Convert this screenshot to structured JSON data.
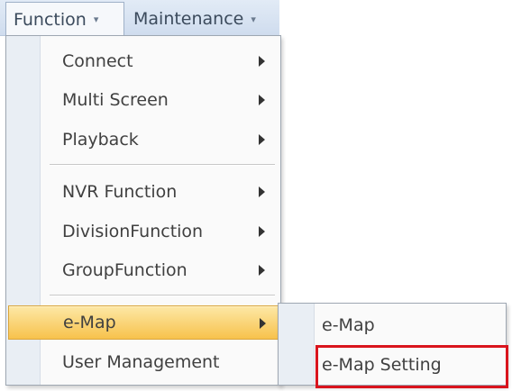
{
  "menubar": {
    "function_label": "Function",
    "maintenance_label": "Maintenance",
    "caret": "▾"
  },
  "function_menu": {
    "items": [
      {
        "label": "Connect",
        "has_submenu": true
      },
      {
        "label": "Multi Screen",
        "has_submenu": true
      },
      {
        "label": "Playback",
        "has_submenu": true
      },
      {
        "label": "NVR Function",
        "has_submenu": true
      },
      {
        "label": "DivisionFunction",
        "has_submenu": true
      },
      {
        "label": "GroupFunction",
        "has_submenu": true
      },
      {
        "label": "e-Map",
        "has_submenu": true,
        "highlighted": true
      },
      {
        "label": "User Management",
        "has_submenu": false
      }
    ]
  },
  "emap_submenu": {
    "items": [
      {
        "label": "e-Map"
      },
      {
        "label": "e-Map Setting",
        "emphasized": true
      }
    ]
  },
  "colors": {
    "highlight": "#f7c24c",
    "emphasis_box": "#d9141d",
    "menubar": "#d6e2f0"
  }
}
